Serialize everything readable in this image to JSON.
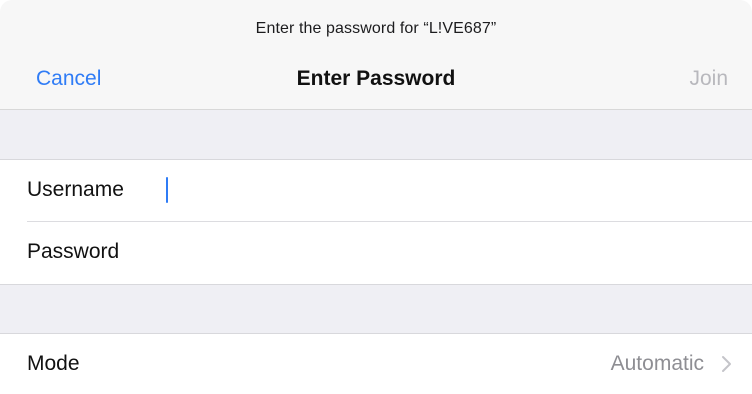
{
  "dialog": {
    "prompt": "Enter the password for “L!VE687”",
    "cancel_label": "Cancel",
    "title": "Enter Password",
    "join_label": "Join"
  },
  "credentials": {
    "username": {
      "label": "Username",
      "value": ""
    },
    "password": {
      "label": "Password",
      "value": ""
    }
  },
  "mode": {
    "label": "Mode",
    "value": "Automatic"
  },
  "colors": {
    "accent": "#2f7cf6",
    "disabled": "#b8b8bd",
    "secondary_text": "#8e8e93",
    "grouped_background": "#efeff4"
  },
  "icons": {
    "mode_disclosure": "chevron-right-icon"
  }
}
